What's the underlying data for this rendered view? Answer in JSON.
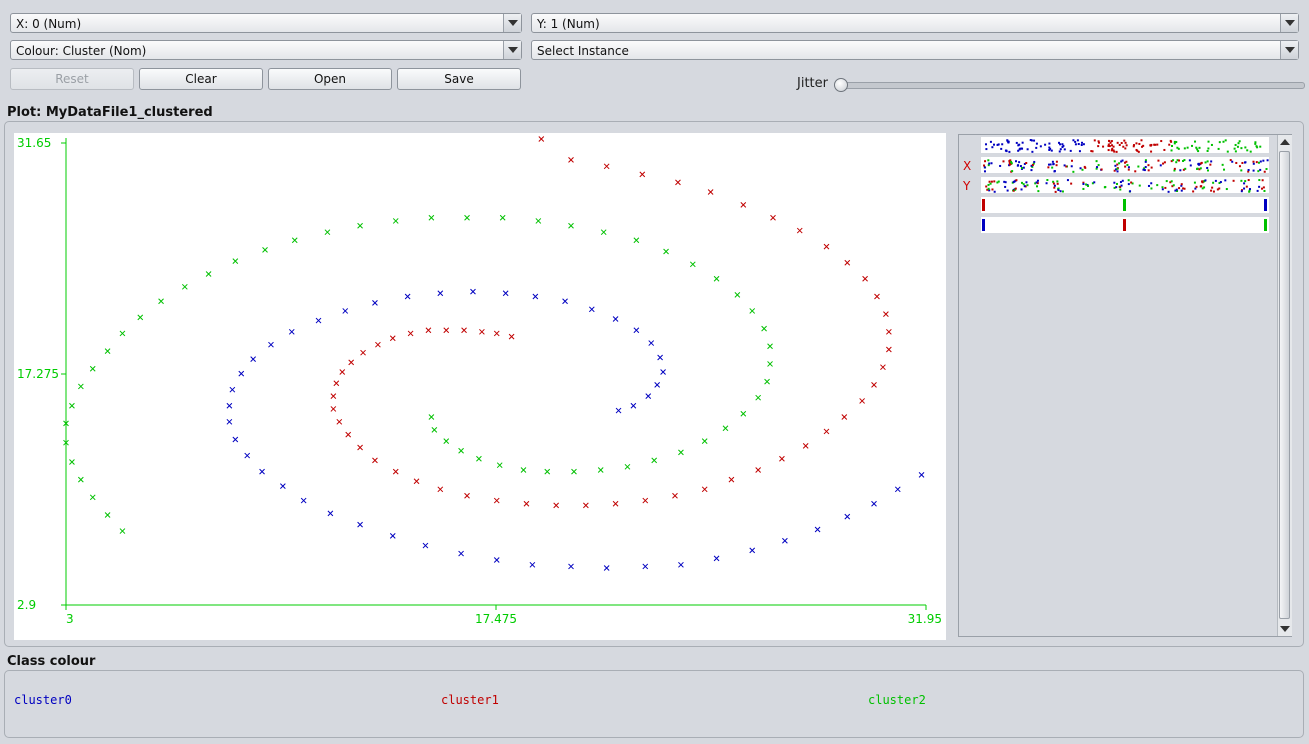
{
  "controls": {
    "x_axis_select": "X: 0 (Num)",
    "y_axis_select": "Y: 1 (Num)",
    "colour_select": "Colour: Cluster (Nom)",
    "instance_select": "Select Instance",
    "reset_label": "Reset",
    "clear_label": "Clear",
    "open_label": "Open",
    "save_label": "Save",
    "jitter_label": "Jitter",
    "jitter_value": 0
  },
  "plot": {
    "title": "Plot: MyDataFile1_clustered"
  },
  "matrix": {
    "x_marker": "X",
    "y_marker": "Y"
  },
  "legend": {
    "title": "Class colour",
    "items": [
      {
        "label": "cluster0",
        "color": "#0000c0"
      },
      {
        "label": "cluster1",
        "color": "#c00000"
      },
      {
        "label": "cluster2",
        "color": "#00c000"
      }
    ]
  },
  "colors": {
    "cluster0": "#0000c0",
    "cluster1": "#c00000",
    "cluster2": "#00c000",
    "axis": "#00cc00"
  },
  "chart_data": {
    "type": "scatter",
    "title": "Plot: MyDataFile1_clustered",
    "xlabel": "",
    "ylabel": "",
    "xlim": [
      3,
      31.95
    ],
    "ylim": [
      2.9,
      31.65
    ],
    "x_ticks": [
      "3",
      "17.475",
      "31.95"
    ],
    "y_ticks": [
      "2.9",
      "17.275",
      "31.65"
    ],
    "marker": "x",
    "grid": false,
    "series": [
      {
        "name": "cluster0",
        "color": "#0000c0",
        "points": [
          [
            21.6,
            15.0
          ],
          [
            22.1,
            15.3
          ],
          [
            22.6,
            15.9
          ],
          [
            22.9,
            16.6
          ],
          [
            23.1,
            17.4
          ],
          [
            23.0,
            18.3
          ],
          [
            22.7,
            19.2
          ],
          [
            22.2,
            20.0
          ],
          [
            21.5,
            20.7
          ],
          [
            20.7,
            21.3
          ],
          [
            19.8,
            21.8
          ],
          [
            18.8,
            22.1
          ],
          [
            17.8,
            22.3
          ],
          [
            16.7,
            22.4
          ],
          [
            15.6,
            22.3
          ],
          [
            14.5,
            22.1
          ],
          [
            13.4,
            21.7
          ],
          [
            12.4,
            21.2
          ],
          [
            11.5,
            20.6
          ],
          [
            10.6,
            19.9
          ],
          [
            9.9,
            19.1
          ],
          [
            9.3,
            18.2
          ],
          [
            8.9,
            17.3
          ],
          [
            8.6,
            16.3
          ],
          [
            8.5,
            15.3
          ],
          [
            8.5,
            14.3
          ],
          [
            8.7,
            13.2
          ],
          [
            9.1,
            12.2
          ],
          [
            9.6,
            11.2
          ],
          [
            10.3,
            10.3
          ],
          [
            11.0,
            9.4
          ],
          [
            11.9,
            8.6
          ],
          [
            12.9,
            7.9
          ],
          [
            14.0,
            7.2
          ],
          [
            15.1,
            6.6
          ],
          [
            16.3,
            6.1
          ],
          [
            17.5,
            5.7
          ],
          [
            18.7,
            5.4
          ],
          [
            20.0,
            5.3
          ],
          [
            21.2,
            5.2
          ],
          [
            22.5,
            5.3
          ],
          [
            23.7,
            5.4
          ],
          [
            24.9,
            5.8
          ],
          [
            26.1,
            6.3
          ],
          [
            27.2,
            6.9
          ],
          [
            28.3,
            7.6
          ],
          [
            29.3,
            8.4
          ],
          [
            30.2,
            9.2
          ],
          [
            31.0,
            10.1
          ],
          [
            31.8,
            11.0
          ]
        ]
      },
      {
        "name": "cluster1",
        "color": "#c00000",
        "points": [
          [
            18.0,
            19.6
          ],
          [
            17.5,
            19.8
          ],
          [
            17.0,
            19.9
          ],
          [
            16.4,
            20.0
          ],
          [
            15.8,
            20.0
          ],
          [
            15.2,
            20.0
          ],
          [
            14.6,
            19.8
          ],
          [
            14.0,
            19.5
          ],
          [
            13.5,
            19.1
          ],
          [
            13.0,
            18.6
          ],
          [
            12.6,
            18.0
          ],
          [
            12.3,
            17.4
          ],
          [
            12.1,
            16.7
          ],
          [
            12.0,
            15.9
          ],
          [
            12.0,
            15.1
          ],
          [
            12.2,
            14.3
          ],
          [
            12.5,
            13.5
          ],
          [
            12.9,
            12.7
          ],
          [
            13.4,
            11.9
          ],
          [
            14.1,
            11.2
          ],
          [
            14.8,
            10.6
          ],
          [
            15.6,
            10.1
          ],
          [
            16.5,
            9.7
          ],
          [
            17.5,
            9.4
          ],
          [
            18.5,
            9.2
          ],
          [
            19.5,
            9.1
          ],
          [
            20.5,
            9.1
          ],
          [
            21.5,
            9.2
          ],
          [
            22.5,
            9.4
          ],
          [
            23.5,
            9.7
          ],
          [
            24.5,
            10.1
          ],
          [
            25.4,
            10.7
          ],
          [
            26.3,
            11.3
          ],
          [
            27.1,
            12.0
          ],
          [
            27.9,
            12.8
          ],
          [
            28.6,
            13.7
          ],
          [
            29.2,
            14.6
          ],
          [
            29.8,
            15.6
          ],
          [
            30.2,
            16.6
          ],
          [
            30.5,
            17.7
          ],
          [
            30.7,
            18.8
          ],
          [
            30.7,
            19.9
          ],
          [
            30.6,
            21.0
          ],
          [
            30.3,
            22.1
          ],
          [
            29.9,
            23.2
          ],
          [
            29.3,
            24.2
          ],
          [
            28.6,
            25.2
          ],
          [
            27.7,
            26.2
          ],
          [
            26.8,
            27.0
          ],
          [
            25.8,
            27.8
          ],
          [
            24.7,
            28.6
          ],
          [
            23.6,
            29.2
          ],
          [
            22.4,
            29.7
          ],
          [
            21.2,
            30.2
          ],
          [
            20.0,
            30.6
          ],
          [
            19.0,
            31.9
          ]
        ]
      },
      {
        "name": "cluster2",
        "color": "#00c000",
        "points": [
          [
            15.3,
            14.6
          ],
          [
            15.4,
            13.8
          ],
          [
            15.8,
            13.1
          ],
          [
            16.3,
            12.5
          ],
          [
            16.9,
            12.0
          ],
          [
            17.6,
            11.6
          ],
          [
            18.4,
            11.3
          ],
          [
            19.2,
            11.2
          ],
          [
            20.1,
            11.2
          ],
          [
            21.0,
            11.3
          ],
          [
            21.9,
            11.5
          ],
          [
            22.8,
            11.9
          ],
          [
            23.7,
            12.4
          ],
          [
            24.5,
            13.1
          ],
          [
            25.2,
            13.9
          ],
          [
            25.8,
            14.8
          ],
          [
            26.3,
            15.8
          ],
          [
            26.6,
            16.8
          ],
          [
            26.7,
            17.9
          ],
          [
            26.7,
            19.0
          ],
          [
            26.5,
            20.1
          ],
          [
            26.1,
            21.2
          ],
          [
            25.6,
            22.2
          ],
          [
            24.9,
            23.2
          ],
          [
            24.1,
            24.1
          ],
          [
            23.2,
            24.9
          ],
          [
            22.2,
            25.6
          ],
          [
            21.1,
            26.1
          ],
          [
            20.0,
            26.5
          ],
          [
            18.9,
            26.8
          ],
          [
            17.7,
            27.0
          ],
          [
            16.5,
            27.0
          ],
          [
            15.3,
            27.0
          ],
          [
            14.1,
            26.8
          ],
          [
            12.9,
            26.5
          ],
          [
            11.8,
            26.1
          ],
          [
            10.7,
            25.6
          ],
          [
            9.7,
            25.0
          ],
          [
            8.7,
            24.3
          ],
          [
            7.8,
            23.5
          ],
          [
            7.0,
            22.7
          ],
          [
            6.2,
            21.8
          ],
          [
            5.5,
            20.8
          ],
          [
            4.9,
            19.8
          ],
          [
            4.4,
            18.7
          ],
          [
            3.9,
            17.6
          ],
          [
            3.5,
            16.5
          ],
          [
            3.2,
            15.3
          ],
          [
            3.0,
            14.2
          ],
          [
            3.0,
            13.0
          ],
          [
            3.2,
            11.8
          ],
          [
            3.5,
            10.7
          ],
          [
            3.9,
            9.6
          ],
          [
            4.4,
            8.5
          ],
          [
            4.9,
            7.5
          ]
        ]
      }
    ]
  }
}
